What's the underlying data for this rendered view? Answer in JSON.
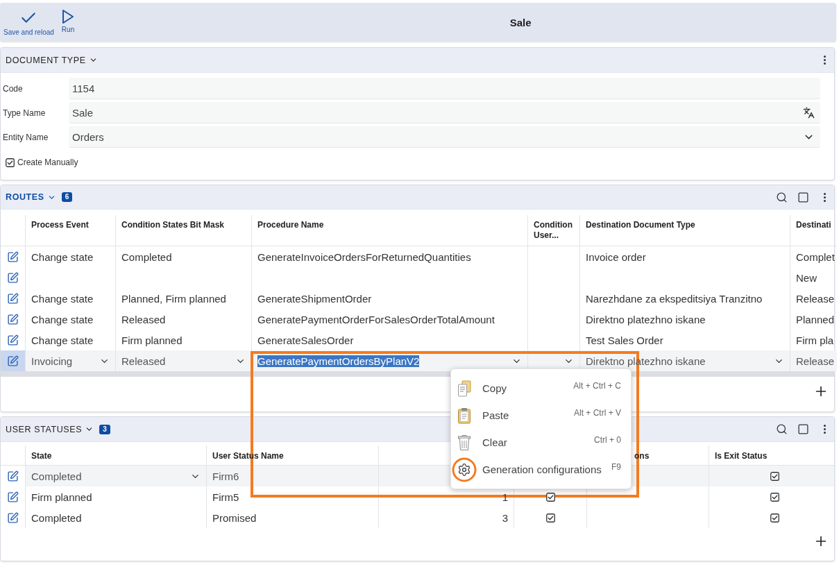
{
  "toolbar": {
    "buttons": [
      {
        "kind": "save",
        "label": "Save and reload"
      },
      {
        "kind": "run",
        "label": "Run"
      }
    ],
    "title": "Sale"
  },
  "document_type": {
    "title": "DOCUMENT TYPE",
    "expanded": true,
    "active": false,
    "fields": [
      {
        "kind": "text",
        "label": "Code",
        "value": "1154"
      },
      {
        "kind": "translatable",
        "label": "Type Name",
        "value": "Sale"
      },
      {
        "kind": "select",
        "label": "Entity Name",
        "value": "Orders"
      }
    ],
    "create_manually": {
      "label": "Create Manually",
      "checked": true
    }
  },
  "routes": {
    "title": "ROUTES",
    "expanded": true,
    "active": true,
    "count": "6",
    "columns": [
      "Process Event",
      "Condition States Bit Mask",
      "Procedure Name",
      "Condition User...",
      "Destination Document Type",
      "Destinati"
    ],
    "rows": [
      {
        "selected": false,
        "procedure_name_highlighted": false,
        "process_event": "Change state",
        "condition_states_bit_mask": "Completed",
        "procedure_name": "GenerateInvoiceOrdersForReturnedQuantities",
        "destination_document_type": "Invoice order",
        "column_6": "Complet"
      },
      {
        "selected": false,
        "column_6": "New"
      },
      {
        "selected": false,
        "procedure_name_highlighted": false,
        "process_event": "Change state",
        "condition_states_bit_mask": "Planned, Firm planned",
        "procedure_name": "GenerateShipmentOrder",
        "destination_document_type": "Narezhdane za ekspeditsiya Tranzitno",
        "column_6": "Release"
      },
      {
        "selected": false,
        "procedure_name_highlighted": false,
        "process_event": "Change state",
        "condition_states_bit_mask": "Released",
        "procedure_name": "GeneratePaymentOrderForSalesOrderTotalAmount",
        "destination_document_type": "Direktno platezhno iskane",
        "column_6": "Planned"
      },
      {
        "selected": false,
        "procedure_name_highlighted": false,
        "process_event": "Change state",
        "condition_states_bit_mask": "Firm planned",
        "procedure_name": "GenerateSalesOrder",
        "destination_document_type": "Test Sales Order",
        "column_6": "Firm pla"
      },
      {
        "selected": true,
        "procedure_name_highlighted": true,
        "process_event": "Invoicing",
        "condition_states_bit_mask": "Released",
        "procedure_name": "GeneratePaymentOrdersByPlanV2",
        "destination_document_type": "Direktno platezhno iskane",
        "column_6": "Release"
      }
    ]
  },
  "user_statuses": {
    "title": "USER STATUSES",
    "expanded": true,
    "active": false,
    "count": "3",
    "columns": {
      "state": "State",
      "user_status_name": "User Status Name",
      "column_5": "ons",
      "is_exit_status": "Is Exit Status"
    },
    "rows": [
      {
        "editing": true,
        "state": "Completed",
        "user_status_name": "Firm6",
        "is_exit_status": true
      },
      {
        "editing": false,
        "state": "Firm planned",
        "user_status_name": "Firm5",
        "column_3": "1",
        "column_4": true,
        "is_exit_status": true
      },
      {
        "editing": false,
        "state": "Completed",
        "user_status_name": "Promised",
        "column_3": "3",
        "column_4": true,
        "is_exit_status": true
      }
    ]
  },
  "context_menu": {
    "items": [
      {
        "kind": "copy",
        "label": "Copy",
        "shortcut": "Alt + Ctrl + C",
        "circled": false
      },
      {
        "kind": "paste",
        "label": "Paste",
        "shortcut": "Alt + Ctrl + V",
        "circled": false
      },
      {
        "kind": "clear",
        "label": "Clear",
        "shortcut": "Ctrl + 0",
        "circled": false
      },
      {
        "kind": "settings",
        "label": "Generation configurations",
        "shortcut": "F9",
        "circled": true
      }
    ]
  },
  "highlight_frame": true
}
